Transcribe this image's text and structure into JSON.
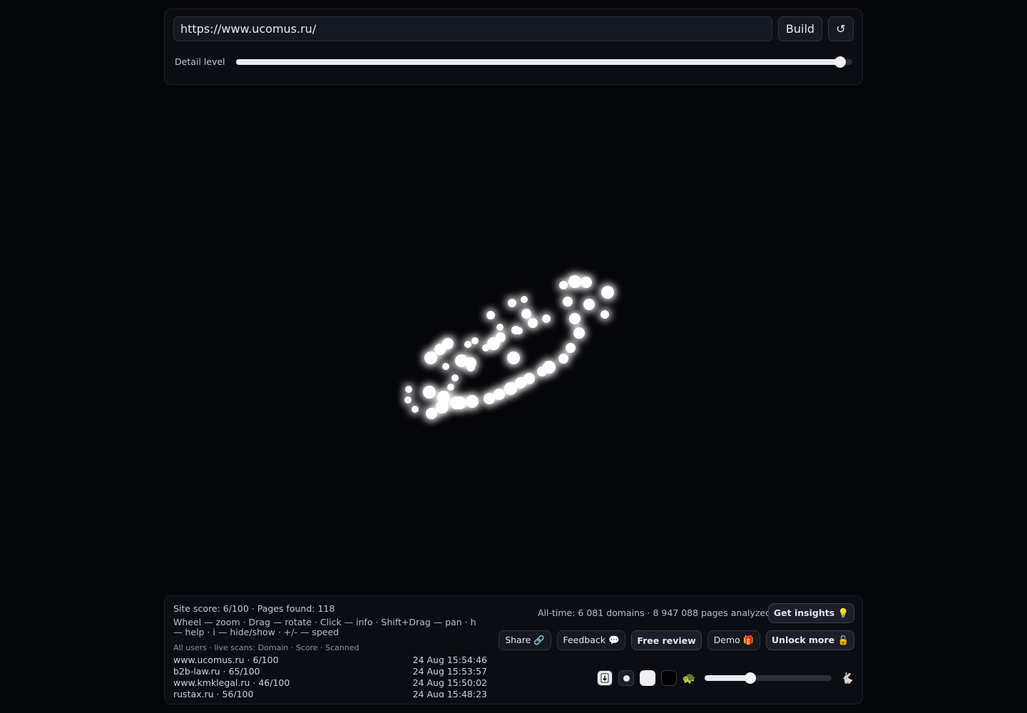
{
  "top": {
    "url_value": "https://www.ucomus.ru/",
    "build_label": "Build",
    "reset_label": "↺",
    "detail_label": "Detail level",
    "detail_level": 0.98
  },
  "status": {
    "site_score": "Site score: 6/100 · Pages found: 118",
    "help": "Wheel — zoom · Drag — rotate · Click — info · Shift+Drag — pan · h — help · i — hide/show · +/- — speed",
    "scans_header": "All users · live scans: Domain · Score · Scanned",
    "scans": [
      {
        "domain": "www.ucomus.ru · 6/100",
        "time": "24 Aug 15:54:46"
      },
      {
        "domain": "b2b-law.ru · 65/100",
        "time": "24 Aug 15:53:57"
      },
      {
        "domain": "www.kmklegal.ru · 46/100",
        "time": "24 Aug 15:50:02"
      },
      {
        "domain": "rustax.ru · 56/100",
        "time": "24 Aug 15:48:23"
      }
    ]
  },
  "stats": {
    "alltime": "All-time: 6 081 domains · 8 947 088 pages analyzed"
  },
  "actions": {
    "insights": "Get insights 💡",
    "share": "Share 🔗",
    "feedback": "Feedback 💬",
    "free_review": "Free review",
    "demo": "Demo 🎁",
    "unlock": "Unlock more 🔓"
  },
  "controls": {
    "slow_icon": "🐢",
    "fast_icon": "🐇",
    "speed": 0.36
  },
  "icons": [
    "download-icon",
    "circle-icon",
    "white-square-icon",
    "black-square-icon",
    "turtle-icon",
    "rabbit-icon"
  ],
  "colors": {
    "background": "#05060a",
    "panel": "#0b0d13",
    "node": "#ffffff"
  }
}
